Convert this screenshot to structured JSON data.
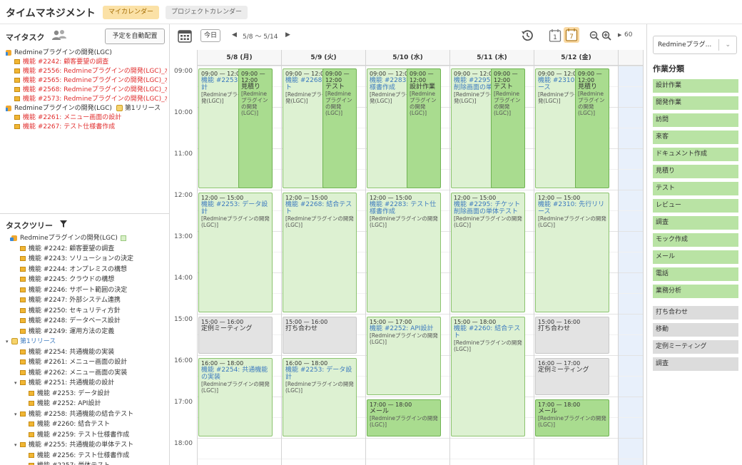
{
  "app": {
    "title": "タイムマネジメント",
    "tabs": [
      {
        "label": "マイカレンダー",
        "active": true
      },
      {
        "label": "プロジェクトカレンダー",
        "active": false
      }
    ]
  },
  "my_tasks": {
    "title": "マイタスク",
    "auto_button": "予定を自動配置",
    "rows": [
      {
        "text": "Redmineプラグインの開発(LGC)",
        "type": "project",
        "color": "normal",
        "indent": 0
      },
      {
        "text": "機能 #2242: 顧客要望の調査",
        "type": "task",
        "color": "red",
        "indent": 1
      },
      {
        "text": "機能 #2556: Redmineプラグインの開発(LGC)_水口",
        "type": "task",
        "color": "red",
        "indent": 1
      },
      {
        "text": "機能 #2565: Redmineプラグインの開発(LGC)_水口",
        "type": "task",
        "color": "red",
        "indent": 1
      },
      {
        "text": "機能 #2568: Redmineプラグインの開発(LGC)_水口",
        "type": "task",
        "color": "red",
        "indent": 1
      },
      {
        "text": "機能 #2573: Redmineプラグインの開発(LGC)_水口",
        "type": "task",
        "color": "red",
        "indent": 1
      },
      {
        "text": "Redmineプラグインの開発(LGC)",
        "suffix": "第1リリース",
        "type": "project",
        "color": "normal",
        "indent": 0
      },
      {
        "text": "機能 #2261: メニュー画面の設計",
        "type": "task",
        "color": "red",
        "indent": 1
      },
      {
        "text": "機能 #2267: テスト仕様書作成",
        "type": "task",
        "color": "red",
        "indent": 1
      }
    ]
  },
  "task_tree": {
    "title": "タスクツリー",
    "rows": [
      {
        "text": "Redmineプラグインの開発(LGC)",
        "type": "project",
        "indent": 0
      },
      {
        "text": "機能 #2242: 顧客要望の調査",
        "type": "task",
        "indent": 1
      },
      {
        "text": "機能 #2243: ソリューションの決定",
        "type": "task",
        "indent": 1
      },
      {
        "text": "機能 #2244: オンプレミスの構想",
        "type": "task",
        "indent": 1
      },
      {
        "text": "機能 #2245: クラウドの構想",
        "type": "task",
        "indent": 1
      },
      {
        "text": "機能 #2246: サポート範囲の決定",
        "type": "task",
        "indent": 1
      },
      {
        "text": "機能 #2247: 外部システム連携",
        "type": "task",
        "indent": 1
      },
      {
        "text": "機能 #2250: セキュリティ方針",
        "type": "task",
        "indent": 1
      },
      {
        "text": "機能 #2248: データベース設計",
        "type": "task",
        "indent": 1
      },
      {
        "text": "機能 #2249: 運用方法の定義",
        "type": "task",
        "indent": 1
      },
      {
        "text": "第1リリース",
        "type": "milestone",
        "indent": 0
      },
      {
        "text": "機能 #2254: 共通機能の実装",
        "type": "task",
        "indent": 1
      },
      {
        "text": "機能 #2261: メニュー画面の設計",
        "type": "task",
        "indent": 1
      },
      {
        "text": "機能 #2262: メニュー画面の実装",
        "type": "task",
        "indent": 1
      },
      {
        "text": "機能 #2251: 共通機能の設計",
        "type": "parent",
        "indent": 1
      },
      {
        "text": "機能 #2253: データ設計",
        "type": "task",
        "indent": 2
      },
      {
        "text": "機能 #2252: API設計",
        "type": "task",
        "indent": 2
      },
      {
        "text": "機能 #2258: 共通機能の結合テスト",
        "type": "parent",
        "indent": 1
      },
      {
        "text": "機能 #2260: 結合テスト",
        "type": "task",
        "indent": 2
      },
      {
        "text": "機能 #2259: テスト仕様書作成",
        "type": "task",
        "indent": 2
      },
      {
        "text": "機能 #2255: 共通機能の単体テスト",
        "type": "parent",
        "indent": 1
      },
      {
        "text": "機能 #2256: テスト仕様書作成",
        "type": "task",
        "indent": 2
      },
      {
        "text": "機能 #2257: 単体テスト",
        "type": "task",
        "indent": 2
      }
    ]
  },
  "calendar": {
    "today_label": "今日",
    "range_label": "5/8 〜 5/14",
    "zoom_value": "60",
    "days": [
      "5/8 (月)",
      "5/9 (火)",
      "5/10 (水)",
      "5/11 (木)",
      "5/12 (金)"
    ],
    "hours": [
      "09:00",
      "10:00",
      "11:00",
      "12:00",
      "13:00",
      "14:00",
      "15:00",
      "16:00",
      "17:00",
      "18:00"
    ],
    "events": [
      {
        "day": 0,
        "start": 9,
        "end": 12,
        "lane": 0,
        "lanes": 2,
        "time": "09:00 — 12:00",
        "title": "機能 #2253: データ設計",
        "project": "[Redmineプラグインの開発(LGC)]",
        "style": "normal"
      },
      {
        "day": 0,
        "start": 9,
        "end": 12,
        "lane": 1,
        "lanes": 2,
        "time": "09:00 — 12:00",
        "title": "見積り",
        "project": "[Redmineプラグインの開発(LGC)]",
        "style": "sel"
      },
      {
        "day": 0,
        "start": 12,
        "end": 15,
        "lane": 0,
        "lanes": 1,
        "time": "12:00 — 15:00",
        "title": "機能 #2253: データ設計",
        "project": "[Redmineプラグインの開発(LGC)]",
        "style": "normal"
      },
      {
        "day": 0,
        "start": 15,
        "end": 16,
        "lane": 0,
        "lanes": 1,
        "time": "15:00 — 16:00",
        "title": "定例ミーティング",
        "project": "",
        "style": "gray"
      },
      {
        "day": 0,
        "start": 16,
        "end": 18,
        "lane": 0,
        "lanes": 1,
        "time": "16:00 — 18:00",
        "title": "機能 #2254: 共通機能の実装",
        "project": "[Redmineプラグインの開発(LGC)]",
        "style": "normal"
      },
      {
        "day": 1,
        "start": 9,
        "end": 12,
        "lane": 0,
        "lanes": 2,
        "time": "09:00 — 12:00",
        "title": "機能 #2268: 結合テスト",
        "project": "[Redmineプラグインの開発(LGC)]",
        "style": "normal"
      },
      {
        "day": 1,
        "start": 9,
        "end": 12,
        "lane": 1,
        "lanes": 2,
        "time": "09:00 — 12:00",
        "title": "テスト",
        "project": "[Redmineプラグインの開発(LGC)]",
        "style": "sel"
      },
      {
        "day": 1,
        "start": 12,
        "end": 15,
        "lane": 0,
        "lanes": 1,
        "time": "12:00 — 15:00",
        "title": "機能 #2268: 結合テスト",
        "project": "[Redmineプラグインの開発(LGC)]",
        "style": "normal"
      },
      {
        "day": 1,
        "start": 15,
        "end": 16,
        "lane": 0,
        "lanes": 1,
        "time": "15:00 — 16:00",
        "title": "打ち合わせ",
        "project": "",
        "style": "gray"
      },
      {
        "day": 1,
        "start": 16,
        "end": 18,
        "lane": 0,
        "lanes": 1,
        "time": "16:00 — 18:00",
        "title": "機能 #2253: データ設計",
        "project": "[Redmineプラグインの開発(LGC)]",
        "style": "normal"
      },
      {
        "day": 2,
        "start": 9,
        "end": 12,
        "lane": 0,
        "lanes": 2,
        "time": "09:00 — 12:00",
        "title": "機能 #2283: テスト仕様書作成",
        "project": "[Redmineプラグインの開発(LGC)]",
        "style": "normal"
      },
      {
        "day": 2,
        "start": 9,
        "end": 12,
        "lane": 1,
        "lanes": 2,
        "time": "09:00 — 12:00",
        "title": "設計作業",
        "project": "[Redmineプラグインの開発(LGC)]",
        "style": "sel"
      },
      {
        "day": 2,
        "start": 12,
        "end": 15,
        "lane": 0,
        "lanes": 1,
        "time": "12:00 — 15:00",
        "title": "機能 #2283: テスト仕様書作成",
        "project": "[Redmineプラグインの開発(LGC)]",
        "style": "normal"
      },
      {
        "day": 2,
        "start": 15,
        "end": 17,
        "lane": 0,
        "lanes": 1,
        "time": "15:00 — 17:00",
        "title": "機能 #2252: API設計",
        "project": "[Redmineプラグインの開発(LGC)]",
        "style": "normal"
      },
      {
        "day": 2,
        "start": 17,
        "end": 18,
        "lane": 0,
        "lanes": 1,
        "time": "17:00 — 18:00",
        "title": "メール",
        "project": "[Redmineプラグインの開発(LGC)]",
        "style": "sel"
      },
      {
        "day": 3,
        "start": 9,
        "end": 12,
        "lane": 0,
        "lanes": 2,
        "time": "09:00 — 12:00",
        "title": "機能 #2295: チケット削除画面の単体テスト",
        "project": "[Redmineプラグインの開発(LGC)]",
        "style": "normal"
      },
      {
        "day": 3,
        "start": 9,
        "end": 12,
        "lane": 1,
        "lanes": 2,
        "time": "09:00 — 12:00",
        "title": "テスト",
        "project": "[Redmineプラグインの開発(LGC)]",
        "style": "sel"
      },
      {
        "day": 3,
        "start": 12,
        "end": 15,
        "lane": 0,
        "lanes": 1,
        "time": "12:00 — 15:00",
        "title": "機能 #2295: チケット削除画面の単体テスト",
        "project": "[Redmineプラグインの開発(LGC)]",
        "style": "normal"
      },
      {
        "day": 3,
        "start": 15,
        "end": 18,
        "lane": 0,
        "lanes": 1,
        "time": "15:00 — 18:00",
        "title": "機能 #2260: 結合テスト",
        "project": "[Redmineプラグインの開発(LGC)]",
        "style": "normal"
      },
      {
        "day": 4,
        "start": 9,
        "end": 12,
        "lane": 0,
        "lanes": 2,
        "time": "09:00 — 12:00",
        "title": "機能 #2310: 先行リリース",
        "project": "[Redmineプラグインの開発(LGC)]",
        "style": "normal"
      },
      {
        "day": 4,
        "start": 9,
        "end": 12,
        "lane": 1,
        "lanes": 2,
        "time": "09:00 — 12:00",
        "title": "見積り",
        "project": "[Redmineプラグインの開発(LGC)]",
        "style": "sel"
      },
      {
        "day": 4,
        "start": 12,
        "end": 15,
        "lane": 0,
        "lanes": 1,
        "time": "12:00 — 15:00",
        "title": "機能 #2310: 先行リリース",
        "project": "[Redmineプラグインの開発(LGC)]",
        "style": "normal"
      },
      {
        "day": 4,
        "start": 15,
        "end": 16,
        "lane": 0,
        "lanes": 1,
        "time": "15:00 — 16:00",
        "title": "打ち合わせ",
        "project": "",
        "style": "gray"
      },
      {
        "day": 4,
        "start": 16,
        "end": 17,
        "lane": 0,
        "lanes": 1,
        "time": "16:00 — 17:00",
        "title": "定例ミーティング",
        "project": "",
        "style": "gray"
      },
      {
        "day": 4,
        "start": 17,
        "end": 18,
        "lane": 0,
        "lanes": 1,
        "time": "17:00 — 18:00",
        "title": "メール",
        "project": "[Redmineプラグインの開発(LGC)]",
        "style": "sel"
      }
    ]
  },
  "right_panel": {
    "project_select": "Redmineプラグ...",
    "title": "作業分類",
    "categories_green": [
      "設計作業",
      "開発作業",
      "訪問",
      "来客",
      "ドキュメント作成",
      "見積り",
      "テスト",
      "レビュー",
      "調査",
      "モック作成",
      "メール",
      "電話",
      "業務分析"
    ],
    "categories_gray": [
      "打ち合わせ",
      "移動",
      "定例ミーティング",
      "調査"
    ]
  }
}
